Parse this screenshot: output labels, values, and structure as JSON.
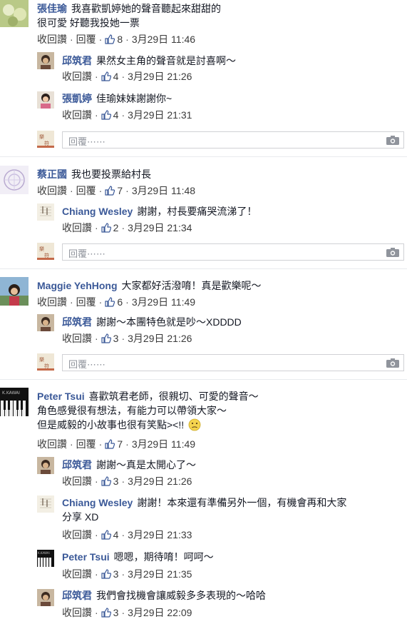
{
  "labels": {
    "reply_inline": "收回讚",
    "reply": "回覆",
    "reply_placeholder": "回覆⋯⋯"
  },
  "comments": [
    {
      "name": "張佳瑜",
      "line1": "我喜歡凱婷她的聲音聽起來甜甜的",
      "line2": "很可愛 好聽我投她一票",
      "likes": "8",
      "time": "3月29日 11:46"
    },
    {
      "name": "邱筑君",
      "line1": "果然女主角的聲音就是討喜啊～",
      "likes": "4",
      "time": "3月29日 21:26"
    },
    {
      "name": "張凱婷",
      "line1": "佳瑜妹妹謝謝你~",
      "likes": "4",
      "time": "3月29日 21:31"
    },
    {
      "name": "蔡正國",
      "line1": "我也要投票給村長",
      "likes": "7",
      "time": "3月29日 11:48"
    },
    {
      "name": "Chiang Wesley",
      "line1": "謝謝，村長要痛哭流涕了！",
      "likes": "2",
      "time": "3月29日 21:34"
    },
    {
      "name": "Maggie YehHong",
      "line1": "大家都好活潑唷！真是歡樂呢～",
      "likes": "6",
      "time": "3月29日 11:49"
    },
    {
      "name": "邱筑君",
      "line1": "謝謝～本團特色就是吵～XDDDD",
      "likes": "3",
      "time": "3月29日 21:26"
    },
    {
      "name": "Peter Tsui",
      "line1": "喜歡筑君老師，很親切、可愛的聲音～",
      "line2": "角色感覺很有想法，有能力可以帶領大家～",
      "line3": "但是威毅的小故事也很有笑點><!!",
      "likes": "7",
      "time": "3月29日 11:49"
    },
    {
      "name": "邱筑君",
      "line1": "謝謝～真是太開心了～",
      "likes": "3",
      "time": "3月29日 21:26"
    },
    {
      "name": "Chiang Wesley",
      "line1": "謝謝！本來還有準備另外一個，有機會再和大家",
      "line2": "分享 XD",
      "likes": "4",
      "time": "3月29日 21:33"
    },
    {
      "name": "Peter Tsui",
      "line1": "嗯嗯，期待唷！呵呵～",
      "likes": "3",
      "time": "3月29日 21:35"
    },
    {
      "name": "邱筑君",
      "line1": "我們會找機會讓威毅多多表現的～哈哈",
      "likes": "3",
      "time": "3月29日 22:09"
    }
  ],
  "colors": {
    "link": "#3b5998",
    "text": "#141823",
    "meta": "#3a3a3a"
  }
}
